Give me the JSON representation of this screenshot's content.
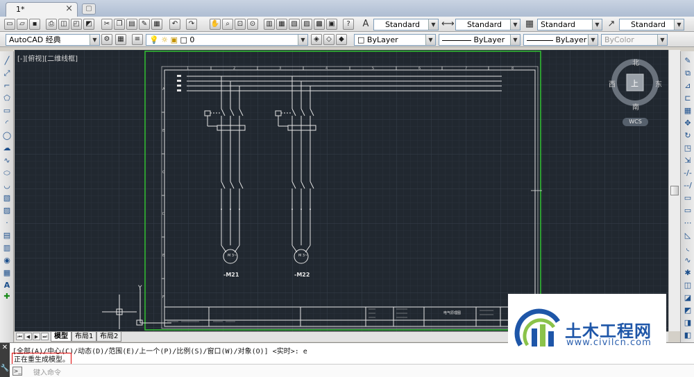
{
  "document": {
    "tab_label": "1*",
    "close_glyph": "×",
    "new_tab_glyph": "▢"
  },
  "toolbar1": {
    "text_style": "Standard",
    "dim_style": "Standard",
    "table_style": "Standard",
    "multileader_style": "Standard"
  },
  "toolbar2": {
    "workspace": "AutoCAD 经典",
    "layer": "0",
    "color": "ByLayer",
    "linetype": "ByLayer",
    "lineweight": "ByLayer",
    "plotstyle": "ByColor"
  },
  "viewport": {
    "label": "[-][俯视][二维线框]",
    "compass": {
      "north": "北",
      "south": "南",
      "east": "东",
      "west": "西",
      "top": "上"
    },
    "wcs": "WCS",
    "motor1": "-M21",
    "motor2": "-M22",
    "motor_symbol": "M\n3~",
    "title_block_name": "电气原理图",
    "frame_numbers": [
      "1",
      "2",
      "3",
      "4",
      "5",
      "6",
      "7",
      "8"
    ],
    "frame_letters": [
      "A",
      "B",
      "C",
      "D",
      "E",
      "F"
    ],
    "axis_y": "Y",
    "axis_x": "X"
  },
  "layout_tabs": {
    "model": "模型",
    "layout1": "布局1",
    "layout2": "布局2"
  },
  "command": {
    "history": "[全部(A)/中心(C)/动态(D)/范围(E)/上一个(P)/比例(S)/窗口(W)/对象(O)] <实时>: e",
    "status": "正在重生成模型。",
    "placeholder": "键入命令"
  },
  "watermark": {
    "title": "土木工程网",
    "url": "www.civilcn.com"
  },
  "colors": {
    "canvas_bg": "#212830",
    "paper_border": "#33c233",
    "drawing_lines": "#e6e6e6"
  }
}
